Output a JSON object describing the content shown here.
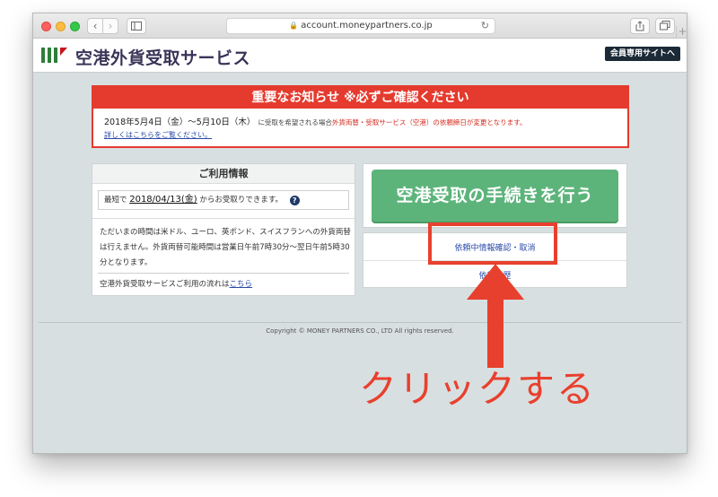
{
  "browser": {
    "url": "account.moneypartners.co.jp",
    "nav_back": "‹",
    "nav_fwd": "›",
    "reload": "↻",
    "new_tab": "+",
    "icons": [
      "back-icon",
      "forward-icon",
      "sidebar-icon",
      "lock-icon",
      "reload-icon",
      "share-icon",
      "tabs-icon",
      "new-tab-icon"
    ]
  },
  "header": {
    "site_title": "空港外貨受取サービス",
    "member_button": "会員専用サイトへ"
  },
  "notice": {
    "heading": "重要なお知らせ ※必ずご確認ください",
    "dates": "2018年5月4日（金）〜5月10日（木）",
    "middle": "に受取を希望される場合",
    "emphasis": "外貨両替・受取サービス（空港）の依頼締日が変更となります。",
    "link": "詳しくはこちらをご覧ください。"
  },
  "info": {
    "title": "ご利用情報",
    "earliest_prefix": "最短で",
    "earliest_date": "2018/04/13(金)",
    "earliest_suffix": "からお受取りできます。",
    "help_glyph": "?",
    "body": "ただいまの時間は米ドル、ユーロ、英ポンド、スイスフランへの外貨両替は行えません。外貨両替可能時間は営業日午前7時30分〜翌日午前5時30分となります。",
    "flow_text": "空港外貨受取サービスご利用の流れは",
    "flow_link": "こちら"
  },
  "actions": {
    "primary_button": "空港受取の手続きを行う",
    "confirm_link": "依頼中情報確認・取消",
    "history_link": "依頼履歴"
  },
  "footer": {
    "copyright": "Copyright © MONEY PARTNERS CO., LTD All rights reserved."
  },
  "annotation": {
    "callout": "クリックする",
    "color": "#e8402e"
  },
  "colors": {
    "notice_red": "#e53a2e",
    "primary_green": "#5db47b",
    "link_blue": "#2a4aa8",
    "page_bg": "#d8dfe0"
  }
}
